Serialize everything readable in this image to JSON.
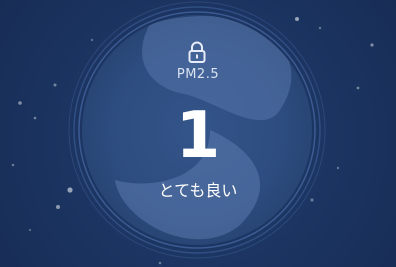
{
  "air_quality": {
    "metric": "PM2.5",
    "value": "1",
    "level_text": "とても良い"
  },
  "icons": {
    "lock": "lock-icon"
  },
  "colors": {
    "background": "#1b3461",
    "dial_fill": "#2e4e80",
    "text": "#ffffff"
  }
}
